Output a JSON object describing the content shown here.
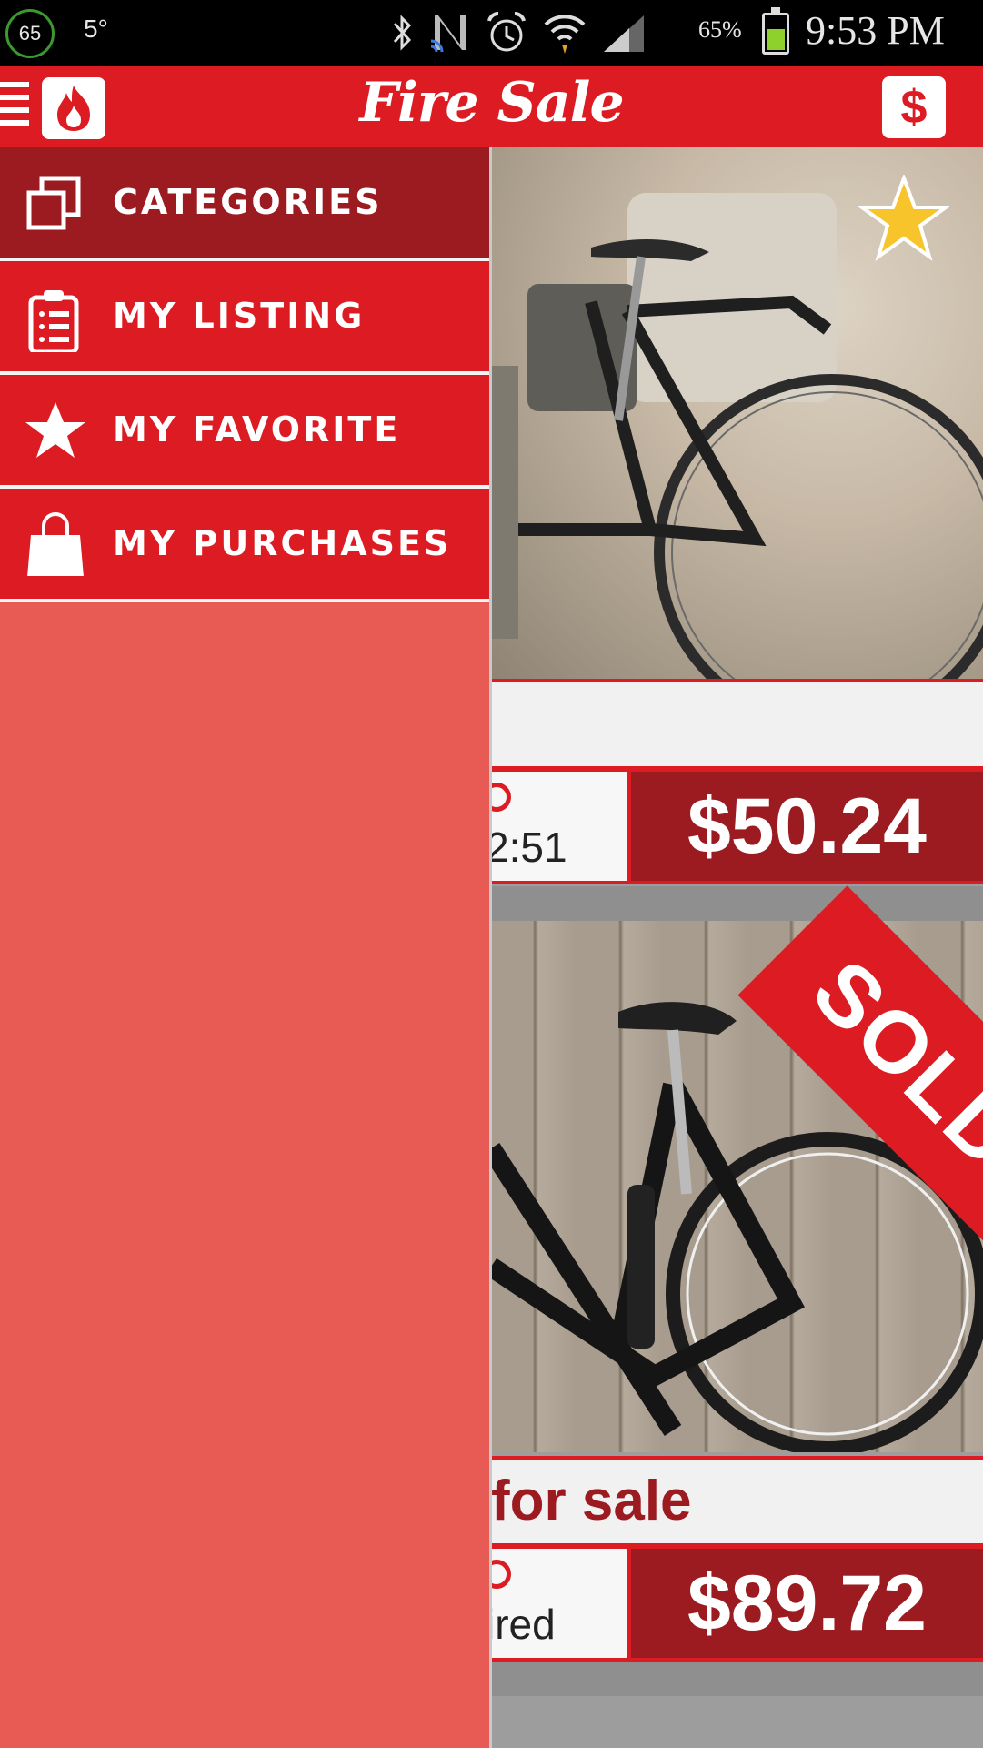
{
  "status_bar": {
    "badge": "65",
    "temperature": "5°",
    "battery_percent": "65%",
    "battery_level": 0.65,
    "time": "9:53 PM"
  },
  "header": {
    "title": "Fire Sale",
    "sell_button_label": "$"
  },
  "drawer": {
    "items": [
      {
        "label": "CATEGORIES",
        "icon": "categories-icon",
        "active": true
      },
      {
        "label": "MY LISTING",
        "icon": "clipboard-icon",
        "active": false
      },
      {
        "label": "MY FAVORITE",
        "icon": "star-icon",
        "active": false
      },
      {
        "label": "MY PURCHASES",
        "icon": "shopping-bag-icon",
        "active": false
      }
    ]
  },
  "listings": [
    {
      "title": "",
      "time_left": "2:51",
      "price": "$50.24",
      "favorited": true,
      "sold": false
    },
    {
      "title": "for sale",
      "time_left": "ired",
      "price": "$89.72",
      "favorited": false,
      "sold": true,
      "sold_label": "SOLD!"
    }
  ],
  "colors": {
    "primary_red": "#dc1c22",
    "dark_red": "#9b1b20",
    "drawer_bg": "#e85a54",
    "star_yellow": "#f7c52b"
  }
}
